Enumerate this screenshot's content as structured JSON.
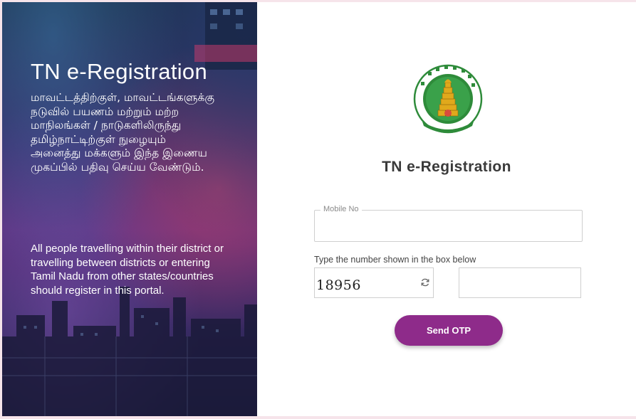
{
  "left_panel": {
    "title": "TN e-Registration",
    "tamil_text": "மாவட்டத்திற்குள், மாவட்டங்களுக்கு நடுவில் பயணம் மற்றும் மற்ற மாநிலங்கள் / நாடுகளிலிருந்து தமிழ்நாட்டிற்குள் நுழையும் அனைத்து மக்களும் இந்த இணைய முகப்பில் பதிவு செய்ய வேண்டும்.",
    "english_text": "All people travelling within their district or travelling between districts or entering Tamil Nadu from other states/countries should register in this portal."
  },
  "form": {
    "title": "TN e-Registration",
    "mobile_label": "Mobile No",
    "mobile_value": "",
    "captcha_label": "Type the number shown in the box below",
    "captcha_value": "18956",
    "captcha_input_value": "",
    "submit_label": "Send OTP"
  },
  "icons": {
    "emblem": "tamil-nadu-emblem",
    "refresh": "refresh-icon"
  },
  "colors": {
    "accent": "#8e2b8a",
    "page_background": "#f6e4ea",
    "emblem_green": "#2e8b3a",
    "emblem_gold": "#e0a91c"
  }
}
